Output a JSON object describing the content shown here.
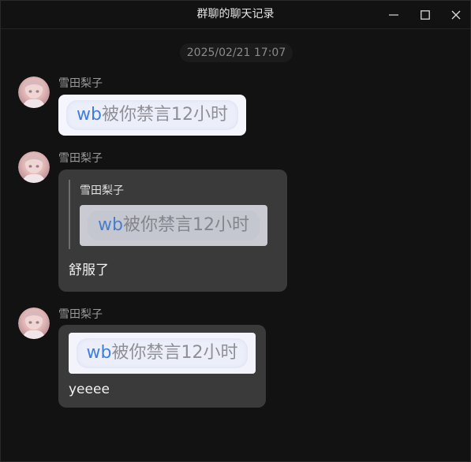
{
  "window": {
    "title": "群聊的聊天记录",
    "controls": [
      "minimize-icon",
      "maximize-icon",
      "close-icon"
    ]
  },
  "timestamp": "2025/02/21 17:07",
  "messages": [
    {
      "sender": "雪田梨子",
      "image_card": {
        "prefix": "wb",
        "text": "被你禁言12小时"
      }
    },
    {
      "sender": "雪田梨子",
      "quote": {
        "sender": "雪田梨子",
        "image_card": {
          "prefix": "wb",
          "text": "被你禁言12小时"
        }
      },
      "text": "舒服了"
    },
    {
      "sender": "雪田梨子",
      "image_card": {
        "prefix": "wb",
        "text": "被你禁言12小时"
      },
      "text": "yeeee"
    }
  ],
  "colors": {
    "background": "#121212",
    "bubble": "#3a3a3a",
    "card": "#f3f4fb",
    "wb_accent": "#3d7fde"
  }
}
